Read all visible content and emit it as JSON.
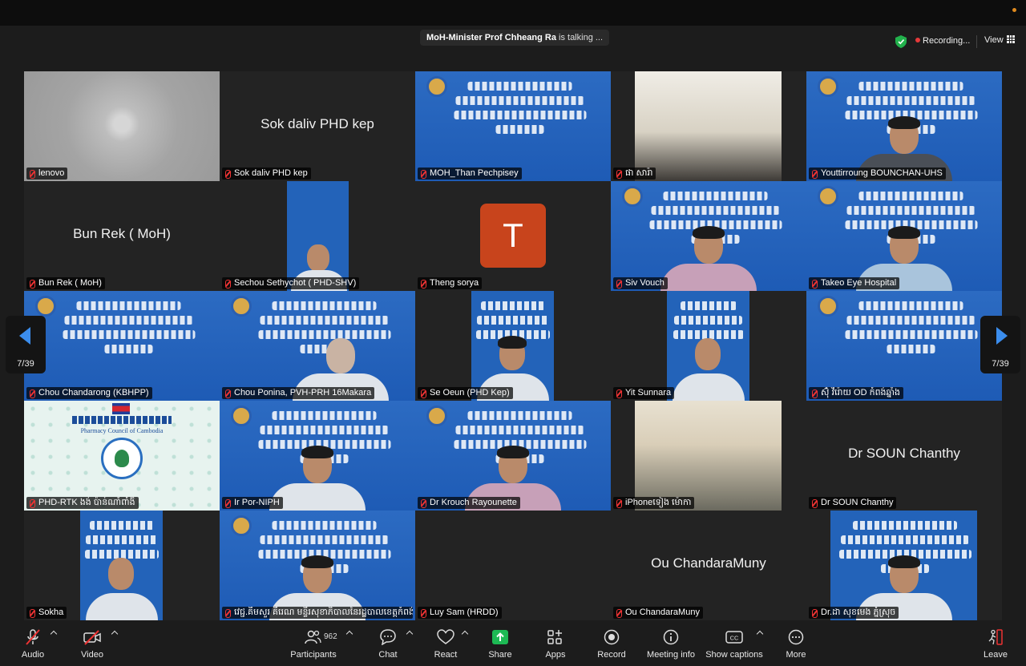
{
  "header": {
    "talking_name": "MoH-Minister Prof Chheang Ra",
    "talking_suffix": " is talking ...",
    "recording_label": "Recording...",
    "view_label": "View"
  },
  "colors": {
    "accent": "#3b8ded",
    "recording": "#e5393a",
    "muted": "#e33333",
    "share": "#1db954",
    "avatar_T": "#c8441c"
  },
  "tiles": [
    {
      "name": "lenovo",
      "big": ""
    },
    {
      "name": "Sok daliv PHD kep",
      "big": "Sok daliv PHD kep"
    },
    {
      "name": "MOH_Than Pechpisey",
      "big": ""
    },
    {
      "name": "ផា សារ៉ា",
      "big": ""
    },
    {
      "name": "Youttirroung BOUNCHAN-UHS",
      "big": ""
    },
    {
      "name": "Bun Rek ( MoH)",
      "big": "Bun Rek ( MoH)"
    },
    {
      "name": "Sechou Sethychot ( PHD-SHV)",
      "big": ""
    },
    {
      "name": "Theng sorya",
      "big": "",
      "avatar": "T"
    },
    {
      "name": "Siv Vouch",
      "big": ""
    },
    {
      "name": "Takeo Eye Hospital",
      "big": ""
    },
    {
      "name": "Chou Chandarong (KBHPP)",
      "big": ""
    },
    {
      "name": "Chou Ponina, PVH-PRH 16Makara",
      "big": ""
    },
    {
      "name": "Se Oeun (PHD Kep)",
      "big": ""
    },
    {
      "name": "Yit Sunnara",
      "big": ""
    },
    {
      "name": "ស៊ុំ វីរ៉ោយ OD កំពង់ឆ្នាំង",
      "big": ""
    },
    {
      "name": "PHD-RTK ងង់ ប៉ាន់ណាំពាំងិ",
      "big": "",
      "pharm": "Pharmacy Council of Cambodia"
    },
    {
      "name": "Ir Por-NIPH",
      "big": ""
    },
    {
      "name": "Dr Krouch Rayounette",
      "big": ""
    },
    {
      "name": "iPhoneទៀង ម៉ោកា",
      "big": ""
    },
    {
      "name": "Dr SOUN Chanthy",
      "big": "Dr SOUN Chanthy"
    },
    {
      "name": "Sokha",
      "big": ""
    },
    {
      "name": "វេជ្ជ.គីមសួរ គីរេណ មន្ទីរសុខាភិបាលនៃរដ្ឋបាលខេត្តកំពង់ចាម",
      "big": ""
    },
    {
      "name": "Luy Sam (HRDD)",
      "big": ""
    },
    {
      "name": "Ou ChandaraMuny",
      "big": "Ou ChandaraMuny"
    },
    {
      "name": "Dr.ដា សុខមេង ភ្នំស្រុច",
      "big": ""
    }
  ],
  "pagination": {
    "left": "7/39",
    "right": "7/39"
  },
  "toolbar": {
    "audio": "Audio",
    "video": "Video",
    "participants": "Participants",
    "participants_count": "962",
    "chat": "Chat",
    "react": "React",
    "share": "Share",
    "apps": "Apps",
    "record": "Record",
    "meeting_info": "Meeting info",
    "captions": "Show captions",
    "more": "More",
    "leave": "Leave"
  }
}
